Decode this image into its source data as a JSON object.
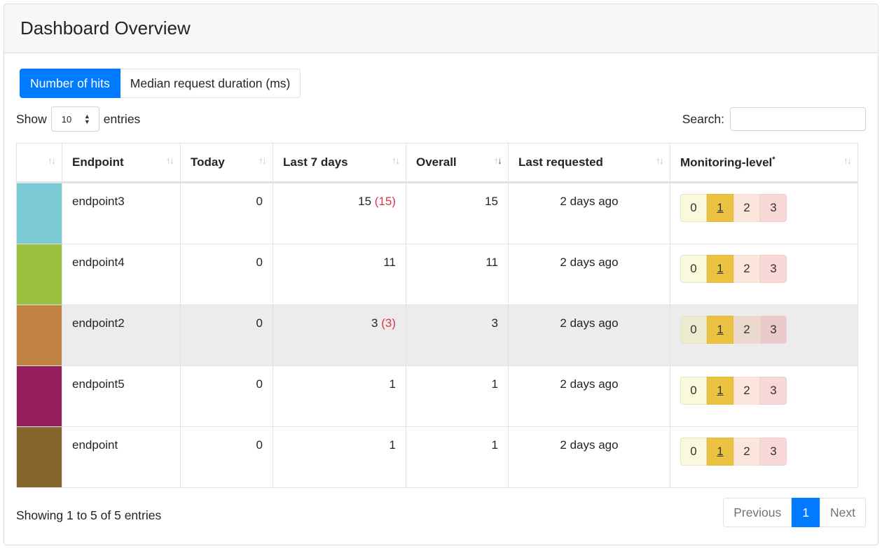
{
  "header": {
    "title": "Dashboard Overview"
  },
  "tabs": [
    {
      "label": "Number of hits",
      "active": true
    },
    {
      "label": "Median request duration (ms)",
      "active": false
    }
  ],
  "length": {
    "show_label": "Show",
    "value": "10",
    "entries_label": "entries"
  },
  "search": {
    "label": "Search:",
    "value": ""
  },
  "table": {
    "columns": [
      "",
      "Endpoint",
      "Today",
      "Last 7 days",
      "Overall",
      "Last requested",
      "Monitoring-level"
    ],
    "monitoring_sup": "*",
    "sorted_column": "Overall",
    "rows": [
      {
        "color": "#7ac9d3",
        "endpoint": "endpoint3",
        "today": "0",
        "last7": "15",
        "last7_extra": "(15)",
        "overall": "15",
        "last_requested": "2 days ago",
        "level": 1
      },
      {
        "color": "#9bc23e",
        "endpoint": "endpoint4",
        "today": "0",
        "last7": "11",
        "last7_extra": "",
        "overall": "11",
        "last_requested": "2 days ago",
        "level": 1
      },
      {
        "color": "#c18342",
        "endpoint": "endpoint2",
        "today": "0",
        "last7": "3",
        "last7_extra": "(3)",
        "overall": "3",
        "last_requested": "2 days ago",
        "level": 1
      },
      {
        "color": "#951f5c",
        "endpoint": "endpoint5",
        "today": "0",
        "last7": "1",
        "last7_extra": "",
        "overall": "1",
        "last_requested": "2 days ago",
        "level": 1
      },
      {
        "color": "#84662c",
        "endpoint": "endpoint",
        "today": "0",
        "last7": "1",
        "last7_extra": "",
        "overall": "1",
        "last_requested": "2 days ago",
        "level": 1
      }
    ],
    "levels": [
      "0",
      "1",
      "2",
      "3"
    ]
  },
  "footer": {
    "info": "Showing 1 to 5 of 5 entries",
    "previous": "Previous",
    "current_page": "1",
    "next": "Next"
  },
  "colors": {
    "accent": "#007bff",
    "delta_red": "#dc3545",
    "level_selected": "#ebc341"
  }
}
